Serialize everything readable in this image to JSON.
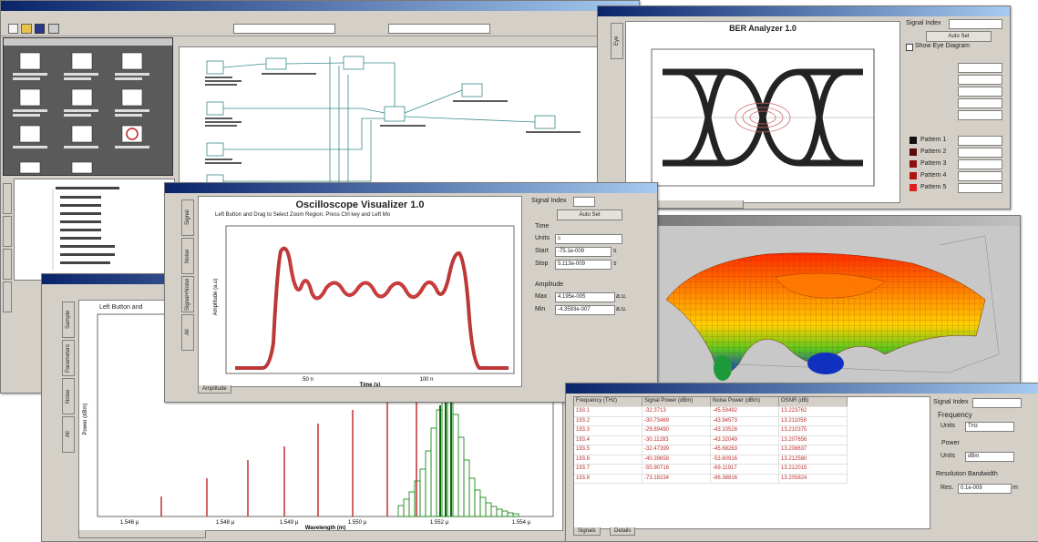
{
  "colors": {
    "titlebar": "#0a246a",
    "trace_red": "#b01515",
    "eye_black": "#111111",
    "hist_green": "#1e8a1e",
    "table_text": "#c03030"
  },
  "ber": {
    "title": "BER Analyzer 1.0",
    "tab": "Eye",
    "signal_index": "Signal Index",
    "auto_set": "Auto Set",
    "show_eye": "Show Eye Diagram",
    "polygon_labels": [
      "Pattern 1",
      "Pattern 2",
      "Pattern 3",
      "Pattern 4",
      "Pattern 5"
    ]
  },
  "osc": {
    "title": "Oscilloscope Visualizer 1.0",
    "subtitle": "Left Button and Drag to Select Zoom Region. Press Ctrl key and Left Mo",
    "tabs": [
      "Signal",
      "Noise",
      "Signal+Noise",
      "All"
    ],
    "bottom_tab": "Amplitude",
    "ylabel": "Amplitude (a.u)",
    "xlabel": "Time (s)",
    "xticks": [
      "50 n",
      "100 n"
    ],
    "signal_index": "Signal Index",
    "auto_set": "Auto Set",
    "time_group": "Time",
    "units_label": "Units",
    "units_value": "s",
    "start_label": "Start",
    "start_value": "-75.1e-009",
    "stop_label": "Stop",
    "stop_value": "5.113e-009",
    "s_unit": "s",
    "amp_group": "Amplitude",
    "max_label": "Max",
    "max_value": "4.195e-005",
    "min_label": "Min",
    "min_value": "-4.3593e-007",
    "a_unit": "a.u."
  },
  "osa": {
    "tabs": [
      "Sample",
      "Parameters",
      "Noise",
      "All"
    ],
    "subtitle": "Left Button and",
    "xlabel": "Wavelength (m)",
    "ylabel": "Power (dBm)",
    "xticks": [
      "1.546 µ",
      "1.548 µ",
      "1.549 µ",
      "1.550 µ",
      "1.552 µ",
      "1.554 µ"
    ]
  },
  "wdm": {
    "columns": [
      "Frequency (THz)",
      "Signal Power (dBm)",
      "Noise Power (dBm)",
      "OSNR (dB)"
    ],
    "rows": [
      [
        "193.1",
        "-32.3713",
        "-45.59492",
        "13.223762"
      ],
      [
        "193.2",
        "-30.73469",
        "-43.94573",
        "13.211058"
      ],
      [
        "193.3",
        "-29.89490",
        "-43.10528",
        "13.210375"
      ],
      [
        "193.4",
        "-30.11283",
        "-43.32049",
        "13.207656"
      ],
      [
        "193.5",
        "-32.47399",
        "-45.68263",
        "13.208637"
      ],
      [
        "193.6",
        "-40.39658",
        "-53.60916",
        "13.212580"
      ],
      [
        "193.7",
        "-55.90716",
        "-69.11917",
        "13.212015"
      ],
      [
        "193.8",
        "-73.18234",
        "-86.38816",
        "13.205824"
      ]
    ],
    "bottom_tabs": [
      "Signals",
      "Details"
    ],
    "signal_index": "Signal Index",
    "frequency_group": "Frequency",
    "units_label": "Units",
    "freq_units": "THz",
    "power_group": "Power",
    "power_units": "dBm",
    "res_group": "Resolution Bandwidth",
    "res_label": "Res.",
    "res_value": "0.1e-009",
    "res_unit": "m"
  }
}
